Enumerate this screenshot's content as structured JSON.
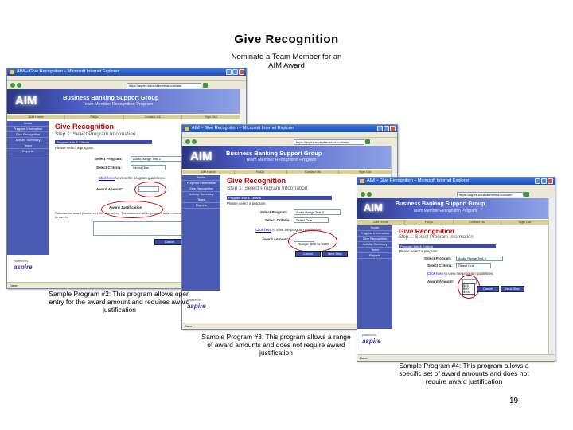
{
  "slide": {
    "title": "Give Recognition",
    "subtitle": "Nominate a Team Member for an AIM Award",
    "page_number": "19"
  },
  "captions": {
    "program2": "Sample Program #2: This program allows open entry for the award amount and requires award justification",
    "program3": "Sample Program #3: This program allows a range of award amounts and does not require award justification",
    "program4": "Sample Program #4: This program allows a specific set of award amounts and does not require award justification"
  },
  "app": {
    "browser_title": "AIM – Give Recognition – Microsoft Internet Explorer",
    "logo": "AIM",
    "brand": "Business Banking Support Group",
    "brand_sub": "Team Member Recognition Program",
    "nav": [
      "AIM Home",
      "FAQs",
      "Contact Us",
      "Sign Out"
    ],
    "sidebar": [
      "Home",
      "Program Information",
      "Give Recognition",
      "Activity Summary",
      "Team",
      "Reports"
    ],
    "page_title": "Give Recognition",
    "step": "Step 1: Select Program Information",
    "section_bar": "Program Info & Criteria",
    "hint": "Please select a program",
    "select_program_label": "Select Program:",
    "select_criteria_label": "Select Criteria:",
    "rules_link": "Click here",
    "rules_text": "to view the program guidelines.",
    "award_amount_label": "Award Amount:",
    "award_justification_label": "Award Justification",
    "cancel_label": "Cancel",
    "next_label": "Next Step",
    "footer_logo": "aspire",
    "footer_pre": "powered by",
    "status": "Done",
    "icons": [
      "ie-icon",
      "back-icon",
      "forward-icon",
      "go-icon",
      "dropdown-arrow-icon"
    ]
  },
  "windows": {
    "w1": {
      "address": "https://aspire.bankofamerica.com/aim",
      "program_value": "Audio Range Test 2",
      "criteria_value": "Select One",
      "range_text": "",
      "justification_note": "Rationale for award (Maximum 1000 characters). The statement will be provided to the nominee so be careful"
    },
    "w2": {
      "address": "https://aspire.bankofamerica.com/aim",
      "program_value": "Audio Range Test 3",
      "criteria_value": "Select One",
      "range_text": "Range: $50 to $500"
    },
    "w3": {
      "address": "https://aspire.bankofamerica.com/aim",
      "program_value": "Audio Range Test 4",
      "criteria_value": "Select One",
      "options": [
        "$25",
        "$50",
        "$100"
      ]
    }
  },
  "colors": {
    "title_bar": "#1e4fb8",
    "banner": "#2a3580",
    "sidebar": "#4b5bb3",
    "page_title": "#c00000",
    "highlight_oval": "#d00000",
    "nav_strip": "#d6cf9a"
  }
}
